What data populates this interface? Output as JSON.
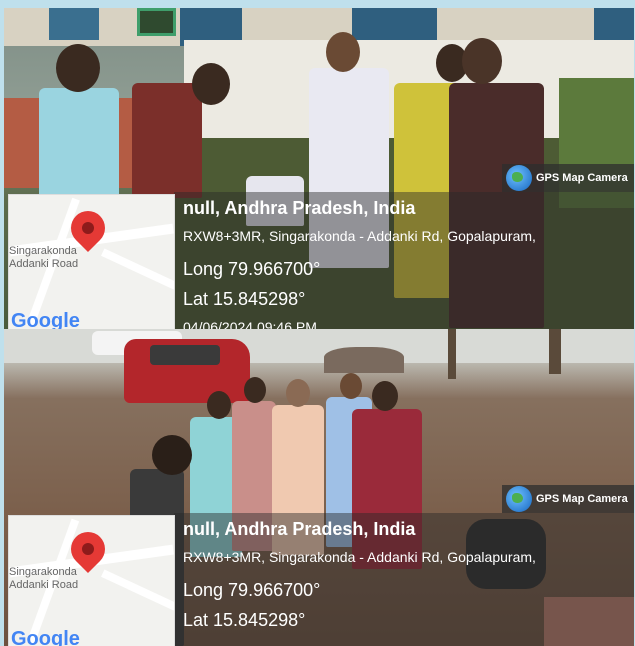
{
  "panels": [
    {
      "badge": "GPS Map Camera",
      "title": "null, Andhra Pradesh, India",
      "address": "RXW8+3MR, Singarakonda - Addanki Rd, Gopalapuram,",
      "longitude": "Long 79.966700°",
      "latitude": "Lat 15.845298°",
      "timestamp": "04/06/2024 09:46 PM",
      "map_labels": [
        "Singarakonda",
        "Addanki Road"
      ],
      "map_brand": "Google"
    },
    {
      "badge": "GPS Map Camera",
      "title": "null, Andhra Pradesh, India",
      "address": "RXW8+3MR, Singarakonda - Addanki Rd, Gopalapuram,",
      "longitude": "Long 79.966700°",
      "latitude": "Lat 15.845298°",
      "map_labels": [
        "Singarakonda",
        "Addanki Road"
      ],
      "map_brand": "Google"
    }
  ],
  "colors": {
    "border": "#bfe0ec",
    "pin": "#e53935",
    "overlay": "rgba(40,40,40,0.45)"
  },
  "icons": [
    "globe-icon",
    "map-pin-icon"
  ]
}
